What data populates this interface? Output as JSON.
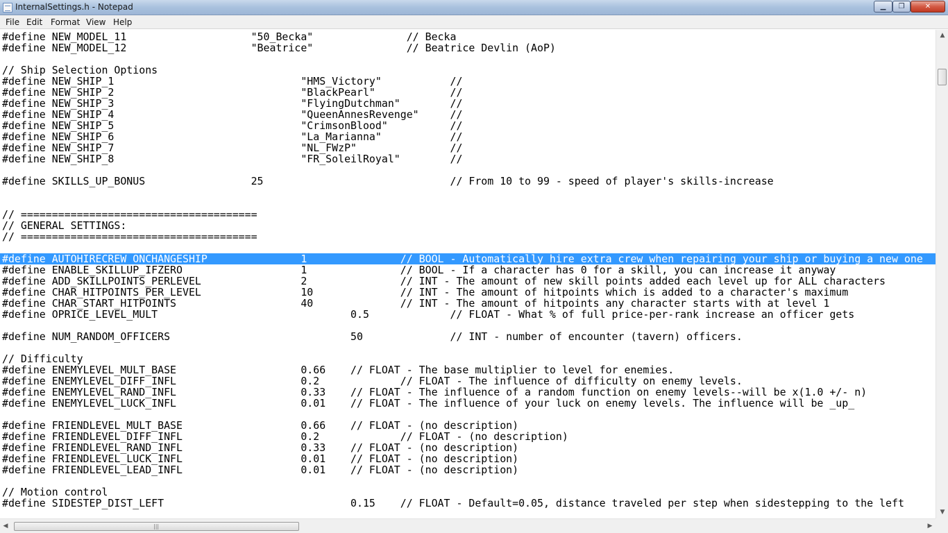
{
  "window": {
    "title": "InternalSettings.h - Notepad",
    "minimize_glyph": "▁",
    "maximize_glyph": "❐",
    "close_glyph": "✕"
  },
  "menu": {
    "file": "File",
    "edit": "Edit",
    "format": "Format",
    "view": "View",
    "help": "Help"
  },
  "editor": {
    "selected_line_index": 20,
    "lines": [
      "#define NEW_MODEL_11                    \"50_Becka\"               // Becka",
      "#define NEW_MODEL_12                    \"Beatrice\"               // Beatrice Devlin (AoP)",
      "",
      "// Ship Selection Options",
      "#define NEW_SHIP_1                              \"HMS_Victory\"           //",
      "#define NEW_SHIP_2                              \"BlackPearl\"            //",
      "#define NEW_SHIP_3                              \"FlyingDutchman\"        //",
      "#define NEW_SHIP_4                              \"QueenAnnesRevenge\"     //",
      "#define NEW_SHIP_5                              \"CrimsonBlood\"          //",
      "#define NEW_SHIP_6                              \"La_Marianna\"           //",
      "#define NEW_SHIP_7                              \"NL_FWzP\"               //",
      "#define NEW_SHIP_8                              \"FR_SoleilRoyal\"        //",
      "",
      "#define SKILLS_UP_BONUS                 25                              // From 10 to 99 - speed of player's skills-increase",
      "",
      "",
      "// ======================================",
      "// GENERAL SETTINGS:",
      "// ======================================",
      "",
      "#define AUTOHIRECREW_ONCHANGESHIP               1               // BOOL - Automatically hire extra crew when repairing your ship or buying a new one",
      "#define ENABLE_SKILLUP_IFZERO                   1               // BOOL - If a character has 0 for a skill, you can increase it anyway",
      "#define ADD_SKILLPOINTS_PERLEVEL                2               // INT - The amount of new skill points added each level up for ALL characters",
      "#define CHAR_HITPOINTS_PER_LEVEL                10              // INT - The amount of hitpoints which is added to a character's maximum",
      "#define CHAR_START_HITPOINTS                    40              // INT - The amount of hitpoints any character starts with at level 1",
      "#define OPRICE_LEVEL_MULT                               0.5             // FLOAT - What % of full price-per-rank increase an officer gets",
      "",
      "#define NUM_RANDOM_OFFICERS                             50              // INT - number of encounter (tavern) officers.",
      "",
      "// Difficulty",
      "#define ENEMYLEVEL_MULT_BASE                    0.66    // FLOAT - The base multiplier to level for enemies.",
      "#define ENEMYLEVEL_DIFF_INFL                    0.2             // FLOAT - The influence of difficulty on enemy levels.",
      "#define ENEMYLEVEL_RAND_INFL                    0.33    // FLOAT - The influence of a random function on enemy levels--will be x(1.0 +/- n)",
      "#define ENEMYLEVEL_LUCK_INFL                    0.01    // FLOAT - The influence of your luck on enemy levels. The influence will be _up_",
      "",
      "#define FRIENDLEVEL_MULT_BASE                   0.66    // FLOAT - (no description)",
      "#define FRIENDLEVEL_DIFF_INFL                   0.2             // FLOAT - (no description)",
      "#define FRIENDLEVEL_RAND_INFL                   0.33    // FLOAT - (no description)",
      "#define FRIENDLEVEL_LUCK_INFL                   0.01    // FLOAT - (no description)",
      "#define FRIENDLEVEL_LEAD_INFL                   0.01    // FLOAT - (no description)",
      "",
      "// Motion control",
      "#define SIDESTEP_DIST_LEFT                              0.15    // FLOAT - Default=0.05, distance traveled per step when sidestepping to the left"
    ]
  },
  "scrollbars": {
    "up_glyph": "▲",
    "down_glyph": "▼",
    "left_glyph": "◀",
    "right_glyph": "▶",
    "grip_glyph": "|||"
  }
}
